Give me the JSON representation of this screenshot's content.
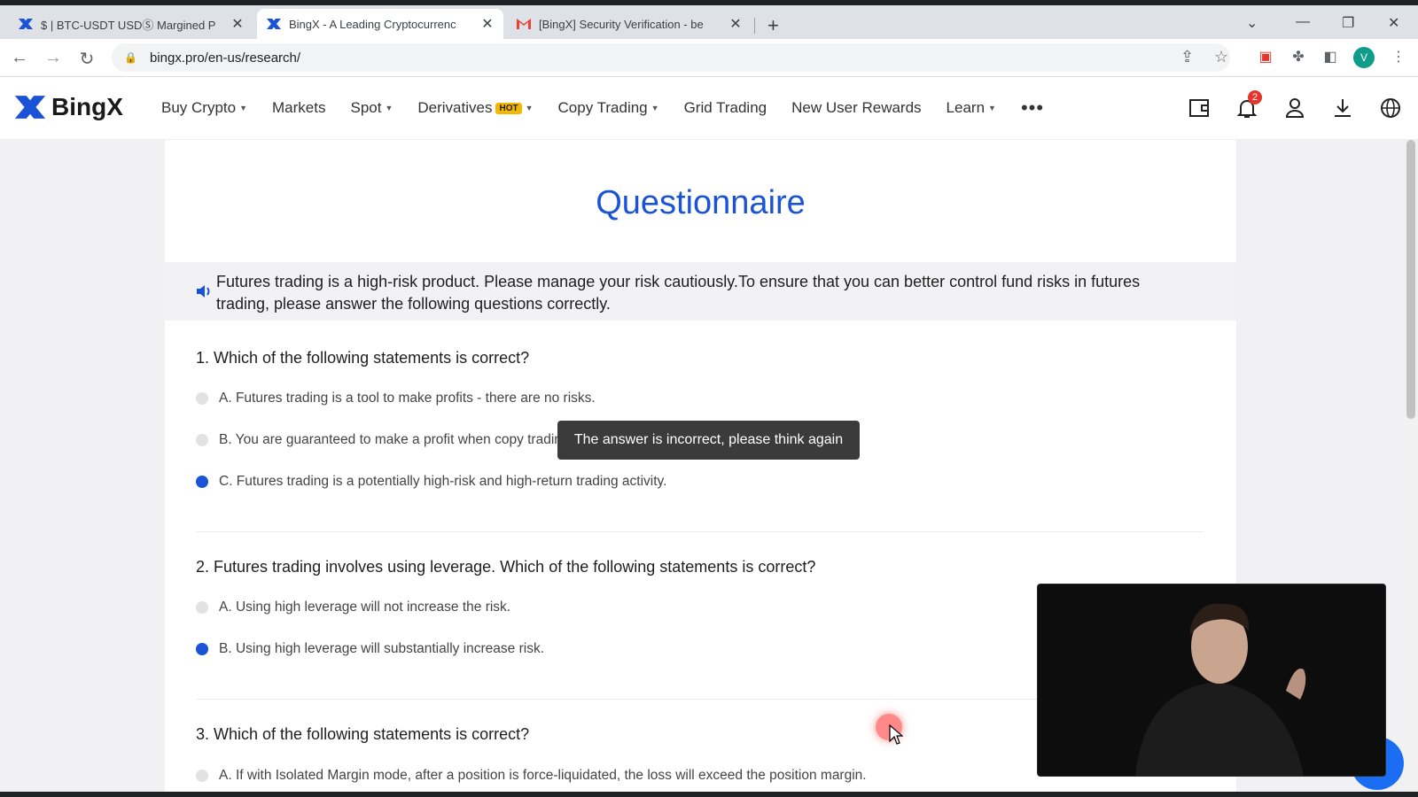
{
  "browser": {
    "tabs": [
      {
        "title": "$ | BTC-USDT USDⓈ Margined P",
        "icon": "bingx-logo-icon"
      },
      {
        "title": "BingX - A Leading Cryptocurrenc",
        "icon": "bingx-logo-icon"
      },
      {
        "title": "[BingX] Security Verification - be",
        "icon": "gmail-icon"
      }
    ],
    "url": "bingx.pro/en-us/research/",
    "profile_initial": "V"
  },
  "site": {
    "brand": "BingX",
    "nav": [
      {
        "label": "Buy Crypto",
        "caret": true
      },
      {
        "label": "Markets",
        "caret": false
      },
      {
        "label": "Spot",
        "caret": true
      },
      {
        "label": "Derivatives",
        "caret": true,
        "badge": "HOT"
      },
      {
        "label": "Copy Trading",
        "caret": true
      },
      {
        "label": "Grid Trading",
        "caret": false
      },
      {
        "label": "New User Rewards",
        "caret": false
      },
      {
        "label": "Learn",
        "caret": true
      }
    ],
    "more_label": "•••",
    "notification_count": "2"
  },
  "page": {
    "title": "Questionnaire",
    "notice": "Futures trading is a high-risk product. Please manage your risk cautiously.To ensure that you can better control fund risks in futures trading, please answer the following questions correctly.",
    "questions": [
      {
        "text": "1. Which of the following statements is correct?",
        "options": [
          {
            "text": "A. Futures trading is a tool to make profits - there are no risks.",
            "selected": false
          },
          {
            "text": "B. You are guaranteed to make a profit when copy trading.",
            "selected": false
          },
          {
            "text": "C. Futures trading is a potentially high-risk and high-return trading activity.",
            "selected": true
          }
        ]
      },
      {
        "text": "2. Futures trading involves using leverage. Which of the following statements is correct?",
        "options": [
          {
            "text": "A. Using high leverage will not increase the risk.",
            "selected": false
          },
          {
            "text": "B. Using high leverage will substantially increase risk.",
            "selected": true
          }
        ]
      },
      {
        "text": "3. Which of the following statements is correct?",
        "options": [
          {
            "text": "A. If with Isolated Margin mode, after a position is force-liquidated, the loss will exceed the position margin.",
            "selected": false
          }
        ]
      }
    ],
    "tooltip": "The answer is incorrect, please think again"
  },
  "colors": {
    "accent": "#1b53d6",
    "hot_badge": "#f5b800",
    "notification_badge": "#e5352b"
  }
}
